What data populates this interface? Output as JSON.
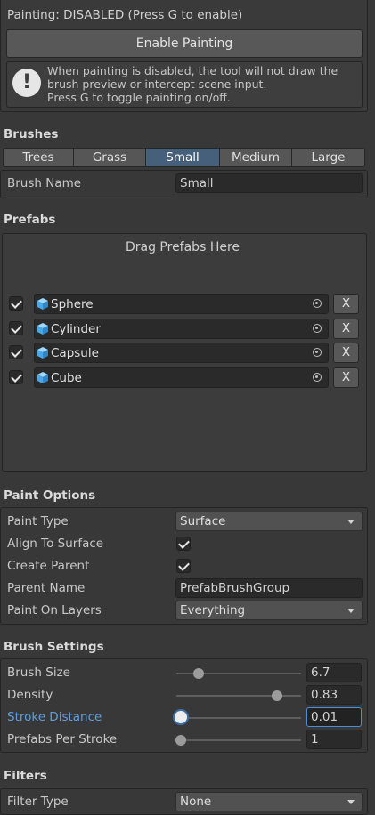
{
  "painting": {
    "status": "Painting: DISABLED (Press G to enable)",
    "enable_button": "Enable Painting",
    "help_line1": "When painting is disabled, the tool will not draw the",
    "help_line2": "brush preview or intercept scene input.",
    "help_line3": "Press G to toggle painting on/off.",
    "help_icon": "exclamation-icon"
  },
  "brushes": {
    "header": "Brushes",
    "tabs": [
      {
        "label": "Trees",
        "active": false
      },
      {
        "label": "Grass",
        "active": false
      },
      {
        "label": "Small",
        "active": true
      },
      {
        "label": "Medium",
        "active": false
      },
      {
        "label": "Large",
        "active": false
      }
    ],
    "name_label": "Brush Name",
    "name_value": "Small"
  },
  "prefabs": {
    "header": "Prefabs",
    "drop_hint": "Drag Prefabs Here",
    "items": [
      {
        "name": "Sphere",
        "checked": true,
        "remove": "X"
      },
      {
        "name": "Cylinder",
        "checked": true,
        "remove": "X"
      },
      {
        "name": "Capsule",
        "checked": true,
        "remove": "X"
      },
      {
        "name": "Cube",
        "checked": true,
        "remove": "X"
      }
    ]
  },
  "paint_options": {
    "header": "Paint Options",
    "paint_type_label": "Paint Type",
    "paint_type_value": "Surface",
    "align_label": "Align To Surface",
    "align_checked": true,
    "create_parent_label": "Create Parent",
    "create_parent_checked": true,
    "parent_name_label": "Parent Name",
    "parent_name_value": "PrefabBrushGroup",
    "layers_label": "Paint On Layers",
    "layers_value": "Everything"
  },
  "brush_settings": {
    "header": "Brush Settings",
    "brush_size_label": "Brush Size",
    "brush_size_value": "6.7",
    "brush_size_fraction": 0.15,
    "density_label": "Density",
    "density_value": "0.83",
    "density_fraction": 0.83,
    "stroke_distance_label": "Stroke Distance",
    "stroke_distance_value": "0.01",
    "stroke_distance_fraction": 0.0,
    "per_stroke_label": "Prefabs Per Stroke",
    "per_stroke_value": "1",
    "per_stroke_fraction": 0.0,
    "accent_color": "#4d8fd6"
  },
  "filters": {
    "header": "Filters",
    "filter_type_label": "Filter Type",
    "filter_type_value": "None"
  }
}
